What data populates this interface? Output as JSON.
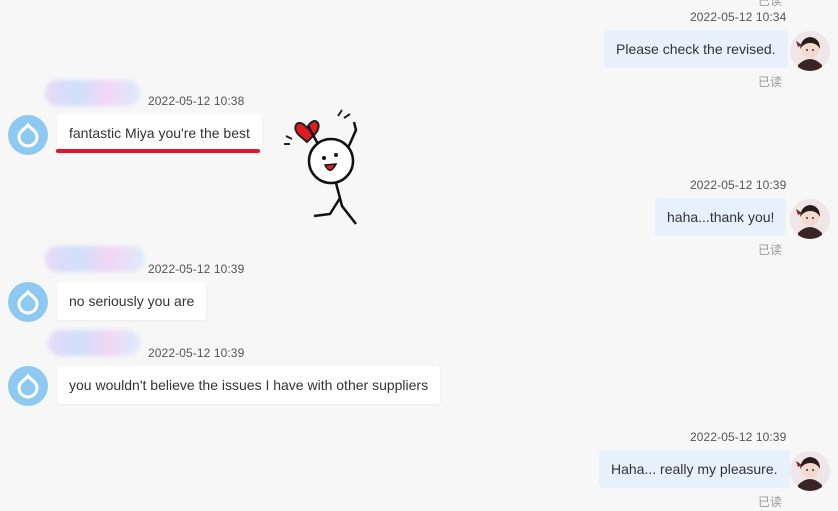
{
  "messages": [
    {
      "id": "m1",
      "side": "right",
      "time": "2022-05-12 10:34",
      "text": "Please check the revised.",
      "status": "已读"
    },
    {
      "id": "m2",
      "side": "left",
      "time": "2022-05-12 10:38",
      "text": "fantastic Miya you're the best"
    },
    {
      "id": "m3",
      "side": "right",
      "time": "2022-05-12 10:39",
      "text": "haha...thank you!",
      "status": "已读"
    },
    {
      "id": "m4",
      "side": "left",
      "time": "2022-05-12 10:39",
      "text": "no seriously you are"
    },
    {
      "id": "m5",
      "side": "left",
      "time": "2022-05-12 10:39",
      "text": "you wouldn't believe the issues I have with other suppliers"
    },
    {
      "id": "m6",
      "side": "right",
      "time": "2022-05-12 10:39",
      "text": "Haha... really my pleasure.",
      "status": "已读"
    }
  ],
  "top_clipped_status": "已读",
  "icons": {
    "contact_avatar": "blue-contact-avatar-icon",
    "user_avatar": "anime-user-avatar-icon",
    "sticker": "stick-figure-heart-sticker"
  },
  "colors": {
    "my_bubble": "#e7f1fc",
    "their_bubble": "#ffffff",
    "highlight_underline": "#e3142d",
    "contact_avatar": "#8ec9f2",
    "background": "#f7f7f7"
  }
}
